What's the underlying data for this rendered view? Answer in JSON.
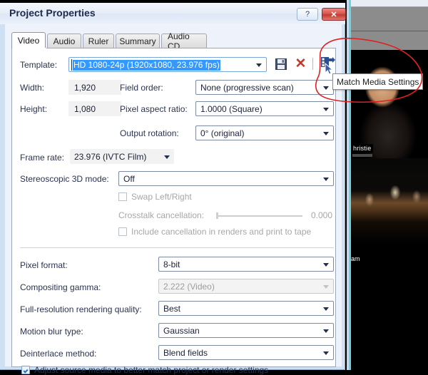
{
  "background_app": {
    "thumb1_caption": "hristie",
    "thumb3_caption": "am"
  },
  "dialog": {
    "title": "Project Properties",
    "help_label": "?",
    "close_label": "✕"
  },
  "tabs": [
    {
      "label": "Video",
      "active": true
    },
    {
      "label": "Audio",
      "active": false
    },
    {
      "label": "Ruler",
      "active": false
    },
    {
      "label": "Summary",
      "active": false
    },
    {
      "label": "Audio CD",
      "active": false
    }
  ],
  "video": {
    "template_label": "Template:",
    "template_value": "HD 1080-24p (1920x1080, 23.976 fps)",
    "save_icon_name": "save-template-icon",
    "delete_icon_name": "delete-template-icon",
    "match_icon_name": "match-media-settings-icon",
    "tooltip": "Match Media Settings",
    "width_label": "Width:",
    "width_value": "1,920",
    "height_label": "Height:",
    "height_value": "1,080",
    "field_order_label": "Field order:",
    "field_order_value": "None (progressive scan)",
    "pixel_aspect_label": "Pixel aspect ratio:",
    "pixel_aspect_value": "1.0000 (Square)",
    "output_rotation_label": "Output rotation:",
    "output_rotation_value": "0° (original)",
    "frame_rate_label": "Frame rate:",
    "frame_rate_value": "23.976 (IVTC Film)",
    "stereo_label": "Stereoscopic 3D mode:",
    "stereo_value": "Off",
    "swap_label": "Swap Left/Right",
    "swap_checked": false,
    "crosstalk_label": "Crosstalk cancellation:",
    "crosstalk_value": "0.000",
    "include_label": "Include cancellation in renders and print to tape",
    "include_checked": false,
    "pixel_format_label": "Pixel format:",
    "pixel_format_value": "8-bit",
    "compositing_gamma_label": "Compositing gamma:",
    "compositing_gamma_value": "2.222 (Video)",
    "render_quality_label": "Full-resolution rendering quality:",
    "render_quality_value": "Best",
    "motion_blur_label": "Motion blur type:",
    "motion_blur_value": "Gaussian",
    "deinterlace_label": "Deinterlace method:",
    "deinterlace_value": "Blend fields",
    "adjust_source_label": "Adjust source media to better match project or render settings",
    "adjust_source_checked": true
  },
  "colors": {
    "selection_blue": "#3399ff",
    "close_red": "#c33a31",
    "annotation_red": "#e02020",
    "title_text": "#1d2a4a"
  }
}
